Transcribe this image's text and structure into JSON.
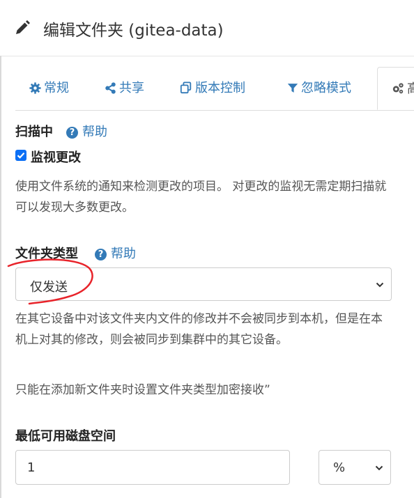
{
  "dialog": {
    "title": "编辑文件夹 (gitea-data)",
    "pencil_icon": "pencil-icon"
  },
  "tabs": [
    {
      "label": "常规",
      "icon": "gear-icon"
    },
    {
      "label": "共享",
      "icon": "share-icon"
    },
    {
      "label": "版本控制",
      "icon": "copy-icon"
    },
    {
      "label": "忽略模式",
      "icon": "filter-icon"
    },
    {
      "label": "高",
      "icon": "cogs-icon"
    }
  ],
  "scanning": {
    "label": "扫描中",
    "help": "帮助",
    "watch_label": "监视更改",
    "watch_checked": true,
    "description": "使用文件系统的通知来检测更改的项目。 对更改的监视无需定期扫描就可以发现大多数更改。"
  },
  "folder_type": {
    "label": "文件夹类型",
    "help": "帮助",
    "selected": "仅发送",
    "description": "在其它设备中对该文件夹内文件的修改并不会被同步到本机，但是在本机上对其的修改，则会被同步到集群中的其它设备。",
    "note": "只能在添加新文件夹时设置文件夹类型加密接收”"
  },
  "min_disk": {
    "label": "最低可用磁盘空间",
    "value": "1",
    "unit": "%"
  },
  "colors": {
    "link": "#337ab7",
    "annotation": "#e8232a",
    "checkbox": "#0b6ff5"
  }
}
